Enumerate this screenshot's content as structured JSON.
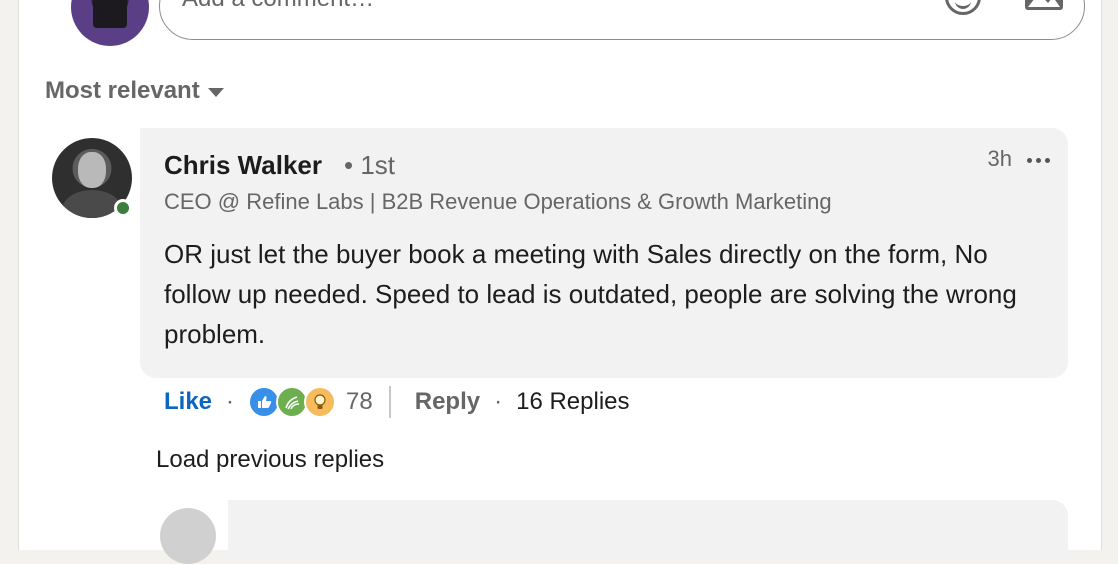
{
  "composer": {
    "placeholder": "Add a comment…"
  },
  "sort": {
    "label": "Most relevant"
  },
  "comment": {
    "author": "Chris Walker",
    "degree": "• 1st",
    "time": "3h",
    "headline": "CEO @ Refine Labs | B2B Revenue Operations & Growth Marketing",
    "text": "OR just let the buyer book a meeting with Sales directly on the form, No follow up needed. Speed to lead is outdated, people are solving the wrong problem.",
    "presence": "online"
  },
  "actions": {
    "like_label": "Like",
    "dot": "·",
    "reaction_icons": [
      "like-icon",
      "celebrate-icon",
      "insightful-icon"
    ],
    "reaction_count": "78",
    "reply_label": "Reply",
    "replies_label": "16 Replies"
  },
  "load_previous": "Load previous replies",
  "colors": {
    "accent": "#0a66c2",
    "bubble": "#f2f2f2",
    "presence": "#3a7d3d"
  }
}
